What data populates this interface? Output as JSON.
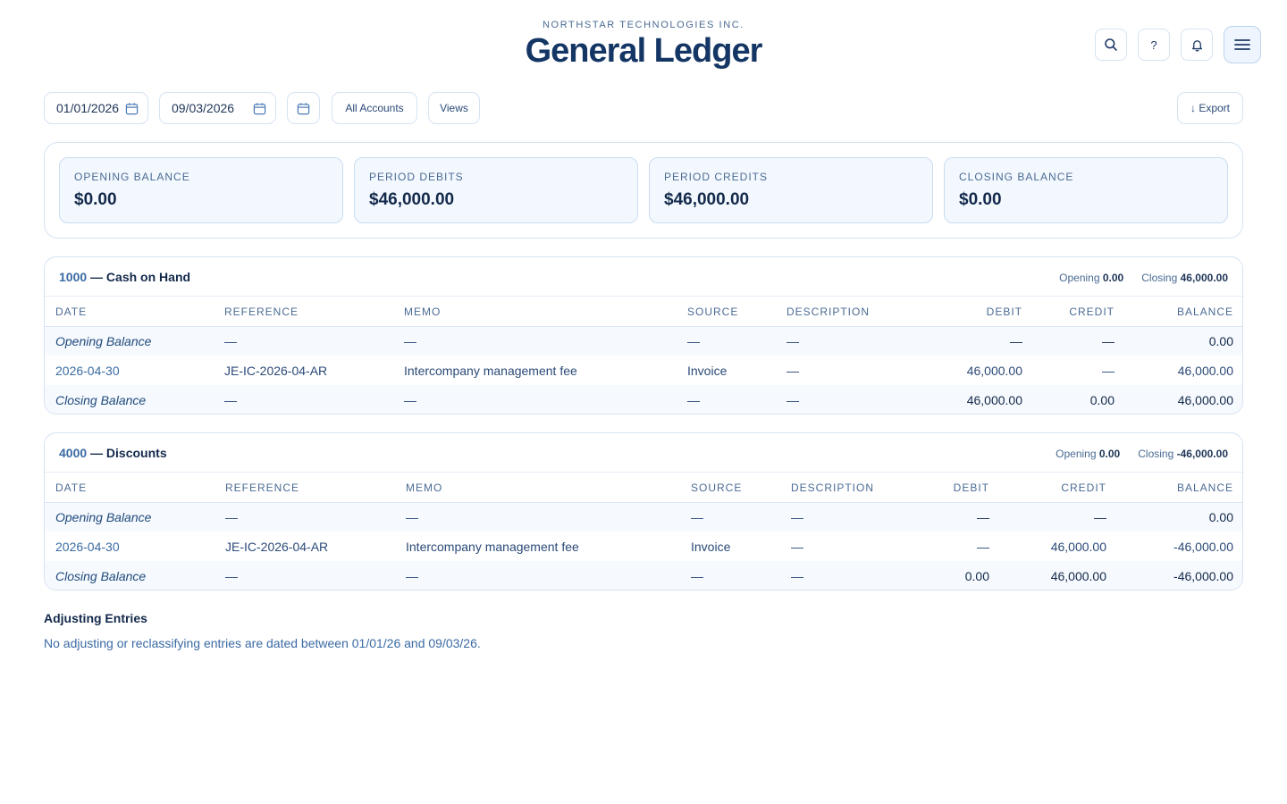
{
  "header": {
    "company": "NORTHSTAR TECHNOLOGIES INC.",
    "title": "General Ledger",
    "help_label": "?"
  },
  "filters": {
    "start_date": "01/01/2026",
    "end_date": "09/03/2026",
    "accounts_label": "All Accounts",
    "views_label": "Views",
    "export_label": "↓ Export"
  },
  "summary": [
    {
      "label": "OPENING BALANCE",
      "value": "$0.00"
    },
    {
      "label": "PERIOD DEBITS",
      "value": "$46,000.00"
    },
    {
      "label": "PERIOD CREDITS",
      "value": "$46,000.00"
    },
    {
      "label": "CLOSING BALANCE",
      "value": "$0.00"
    }
  ],
  "columns": [
    "DATE",
    "REFERENCE",
    "MEMO",
    "SOURCE",
    "DESCRIPTION",
    "DEBIT",
    "CREDIT",
    "BALANCE"
  ],
  "accounts": [
    {
      "code": "1000",
      "name": " — Cash on Hand",
      "opening_label": "Opening",
      "opening_value": "0.00",
      "closing_label": "Closing",
      "closing_value": "46,000.00",
      "rows": [
        [
          "Opening Balance",
          "—",
          "—",
          "—",
          "—",
          "—",
          "—",
          "0.00"
        ],
        [
          "2026-04-30",
          "JE-IC-2026-04-AR",
          "Intercompany management fee",
          "Invoice",
          "—",
          "46,000.00",
          "—",
          "46,000.00"
        ],
        [
          "Closing Balance",
          "—",
          "—",
          "—",
          "—",
          "46,000.00",
          "0.00",
          "46,000.00"
        ]
      ]
    },
    {
      "code": "4000",
      "name": " — Discounts",
      "opening_label": "Opening",
      "opening_value": "0.00",
      "closing_label": "Closing",
      "closing_value": "-46,000.00",
      "rows": [
        [
          "Opening Balance",
          "—",
          "—",
          "—",
          "—",
          "—",
          "—",
          "0.00"
        ],
        [
          "2026-04-30",
          "JE-IC-2026-04-AR",
          "Intercompany management fee",
          "Invoice",
          "—",
          "—",
          "46,000.00",
          "-46,000.00"
        ],
        [
          "Closing Balance",
          "—",
          "—",
          "—",
          "—",
          "0.00",
          "46,000.00",
          "-46,000.00"
        ]
      ]
    }
  ],
  "adjusting": {
    "title": "Adjusting Entries",
    "text": "No adjusting or reclassifying entries are dated between 01/01/26 and 09/03/26."
  }
}
